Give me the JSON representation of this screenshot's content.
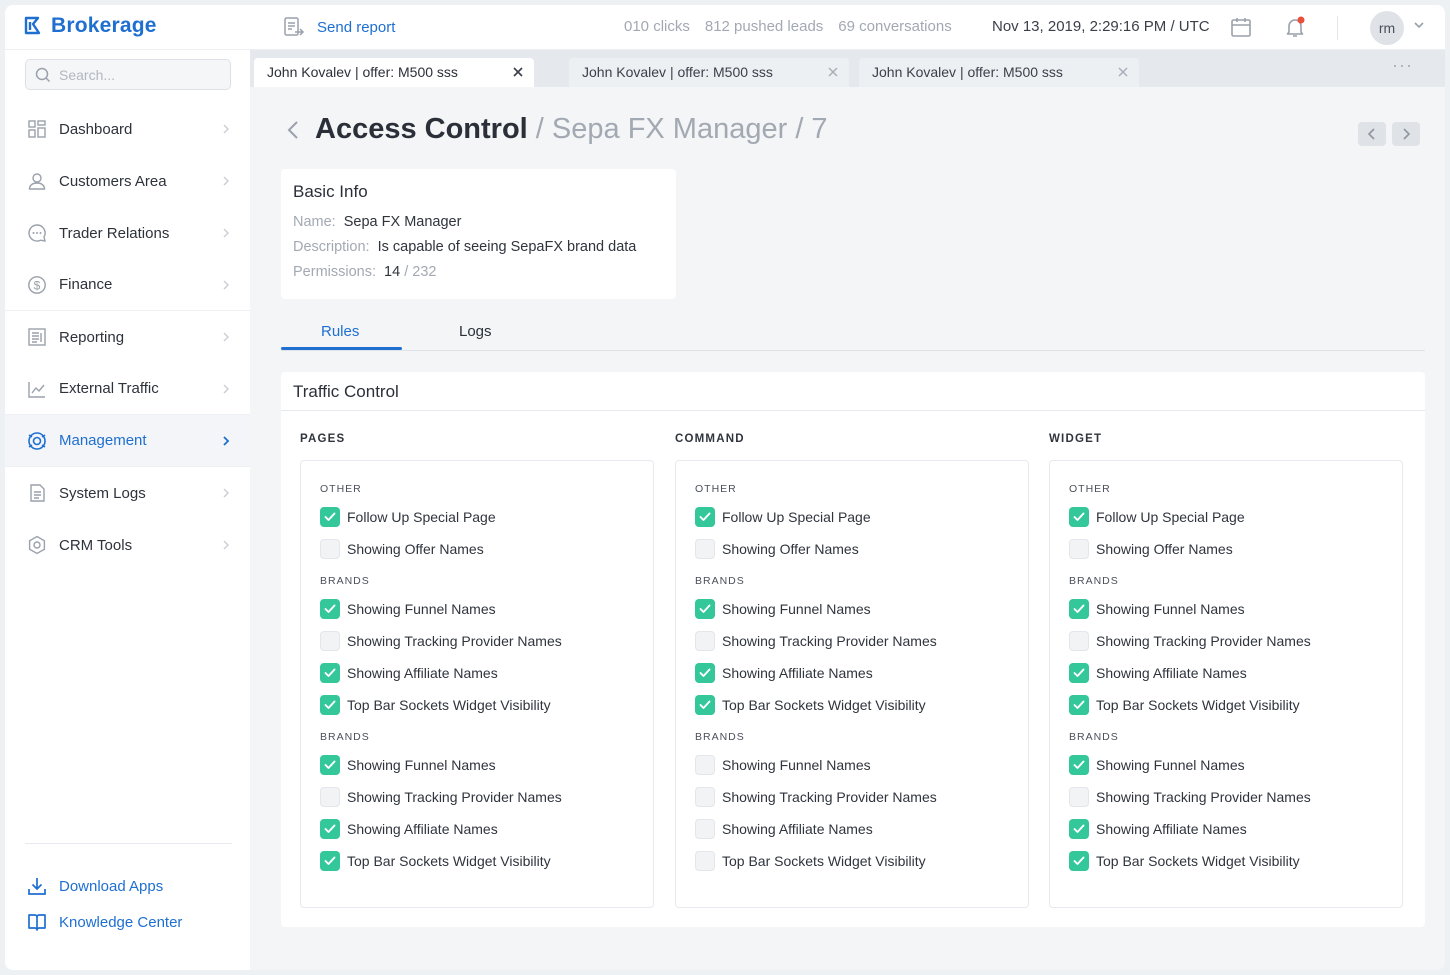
{
  "app": {
    "name": "Brokerage"
  },
  "topbar": {
    "send_report": "Send report",
    "stats": [
      "010 clicks",
      "812 pushed leads",
      "69 conversations"
    ],
    "datetime": "Nov 13, 2019, 2:29:16 PM / UTC",
    "avatar_initials": "rm",
    "notification_badge_color": "#e8503a"
  },
  "search": {
    "placeholder": "Search..."
  },
  "sidebar": {
    "items": [
      {
        "label": "Dashboard",
        "icon": "dashboard-icon"
      },
      {
        "label": "Customers Area",
        "icon": "user-icon"
      },
      {
        "label": "Trader Relations",
        "icon": "chat-icon"
      },
      {
        "label": "Finance",
        "icon": "dollar-icon"
      },
      {
        "label": "Reporting",
        "icon": "report-icon"
      },
      {
        "label": "External Traffic",
        "icon": "chart-line-icon"
      },
      {
        "label": "Management",
        "icon": "management-icon",
        "active": true
      },
      {
        "label": "System Logs",
        "icon": "document-icon"
      },
      {
        "label": "CRM Tools",
        "icon": "gear-icon"
      }
    ],
    "download_apps": "Download Apps",
    "knowledge_center": "Knowledge Center"
  },
  "doc_tabs": [
    {
      "label": "John Kovalev | offer: M500 sss",
      "active": true
    },
    {
      "label": "John Kovalev | offer: M500 sss",
      "active": false
    },
    {
      "label": "John Kovalev | offer: M500 sss",
      "active": false
    }
  ],
  "page": {
    "title": "Access Control",
    "crumb": " / Sepa FX Manager / 7"
  },
  "basic_info": {
    "title": "Basic Info",
    "name_label": "Name:",
    "name_value": "Sepa FX Manager",
    "description_label": "Description:",
    "description_value": "Is capable of seeing SepaFX brand data",
    "permissions_label": "Permissions:",
    "permissions_value": "14",
    "permissions_total": " / 232"
  },
  "tabs": [
    {
      "label": "Rules",
      "active": true
    },
    {
      "label": "Logs",
      "active": false
    }
  ],
  "traffic_control": {
    "title": "Traffic Control",
    "columns": [
      {
        "title": "PAGES",
        "groups": [
          {
            "label": "OTHER",
            "items": [
              {
                "label": "Follow Up Special Page",
                "checked": true
              },
              {
                "label": "Showing Offer Names",
                "checked": false
              }
            ]
          },
          {
            "label": "BRANDS",
            "items": [
              {
                "label": "Showing Funnel Names",
                "checked": true
              },
              {
                "label": "Showing Tracking Provider Names",
                "checked": false
              },
              {
                "label": "Showing Affiliate Names",
                "checked": true
              },
              {
                "label": "Top Bar Sockets Widget Visibility",
                "checked": true
              }
            ]
          },
          {
            "label": "BRANDS",
            "items": [
              {
                "label": "Showing Funnel Names",
                "checked": true
              },
              {
                "label": "Showing Tracking Provider Names",
                "checked": false
              },
              {
                "label": "Showing Affiliate Names",
                "checked": true
              },
              {
                "label": "Top Bar Sockets Widget Visibility",
                "checked": true
              }
            ]
          }
        ]
      },
      {
        "title": "COMMAND",
        "groups": [
          {
            "label": "OTHER",
            "items": [
              {
                "label": "Follow Up Special Page",
                "checked": true
              },
              {
                "label": "Showing Offer Names",
                "checked": false
              }
            ]
          },
          {
            "label": "BRANDS",
            "items": [
              {
                "label": "Showing Funnel Names",
                "checked": true
              },
              {
                "label": "Showing Tracking Provider Names",
                "checked": false
              },
              {
                "label": "Showing Affiliate Names",
                "checked": true
              },
              {
                "label": "Top Bar Sockets Widget Visibility",
                "checked": true
              }
            ]
          },
          {
            "label": "BRANDS",
            "items": [
              {
                "label": "Showing Funnel Names",
                "checked": false
              },
              {
                "label": "Showing Tracking Provider Names",
                "checked": false
              },
              {
                "label": "Showing Affiliate Names",
                "checked": false
              },
              {
                "label": "Top Bar Sockets Widget Visibility",
                "checked": false
              }
            ]
          }
        ]
      },
      {
        "title": "WIDGET",
        "groups": [
          {
            "label": "OTHER",
            "items": [
              {
                "label": "Follow Up Special Page",
                "checked": true
              },
              {
                "label": "Showing Offer Names",
                "checked": false
              }
            ]
          },
          {
            "label": "BRANDS",
            "items": [
              {
                "label": "Showing Funnel Names",
                "checked": true
              },
              {
                "label": "Showing Tracking Provider Names",
                "checked": false
              },
              {
                "label": "Showing Affiliate Names",
                "checked": true
              },
              {
                "label": "Top Bar Sockets Widget Visibility",
                "checked": true
              }
            ]
          },
          {
            "label": "BRANDS",
            "items": [
              {
                "label": "Showing Funnel Names",
                "checked": true
              },
              {
                "label": "Showing Tracking Provider Names",
                "checked": false
              },
              {
                "label": "Showing Affiliate Names",
                "checked": true
              },
              {
                "label": "Top Bar Sockets Widget Visibility",
                "checked": true
              }
            ]
          }
        ]
      }
    ]
  },
  "colors": {
    "accent": "#1f6fd1",
    "check": "#33c79a"
  }
}
